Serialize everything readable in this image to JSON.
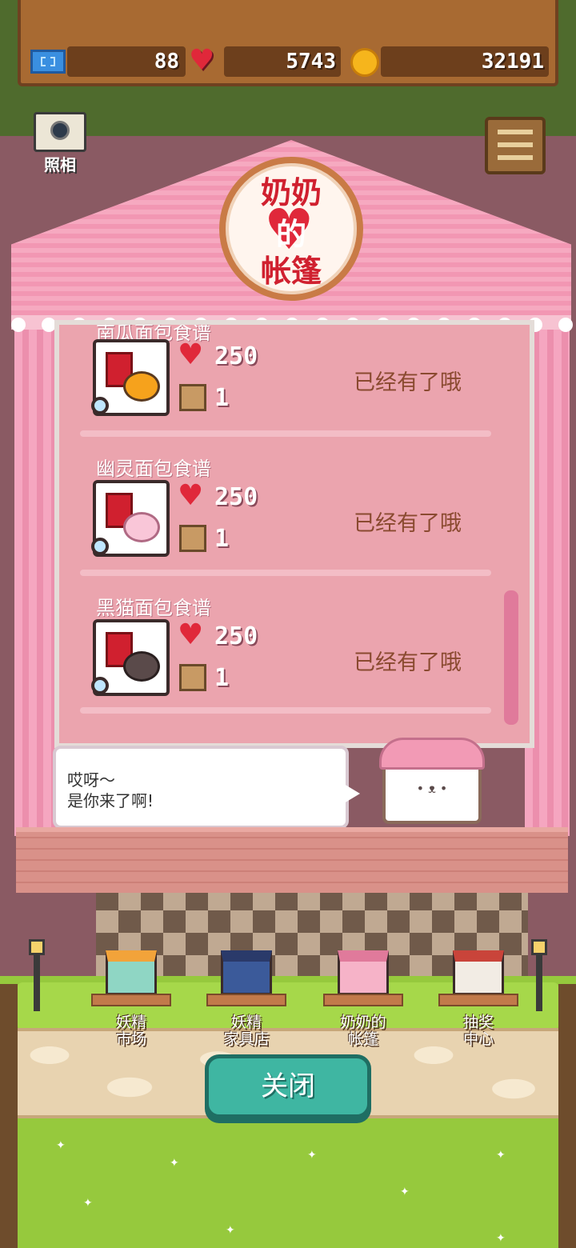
{
  "resources": {
    "tickets": "88",
    "hearts": "5743",
    "coins": "32191"
  },
  "side_buttons": {
    "camera_label": "照相"
  },
  "tent_sign": {
    "line1": "奶奶",
    "line2": "的",
    "line3": "帐篷"
  },
  "list": {
    "items": [
      {
        "title": "南瓜面包食谱",
        "heart_cost": "250",
        "box_cost": "1",
        "status": "已经有了哦",
        "food_color": "#f6a21c"
      },
      {
        "title": "幽灵面包食谱",
        "heart_cost": "250",
        "box_cost": "1",
        "status": "已经有了哦",
        "food_color": "#f9c6d8"
      },
      {
        "title": "黑猫面包食谱",
        "heart_cost": "250",
        "box_cost": "1",
        "status": "已经有了哦",
        "food_color": "#5a4a4a"
      }
    ]
  },
  "dialog": {
    "line1": "哎呀～",
    "line2": "是你来了啊!"
  },
  "shops": [
    {
      "label_line1": "妖精",
      "label_line2": "市场"
    },
    {
      "label_line1": "妖精",
      "label_line2": "家具店"
    },
    {
      "label_line1": "奶奶的",
      "label_line2": "帐篷"
    },
    {
      "label_line1": "抽奖",
      "label_line2": "中心"
    }
  ],
  "close_button": {
    "label": "关闭"
  },
  "colors": {
    "heart": "#e0283a",
    "coin": "#f6b51c",
    "close_button": "#3fb6a2",
    "panel": "#eba4ae"
  }
}
